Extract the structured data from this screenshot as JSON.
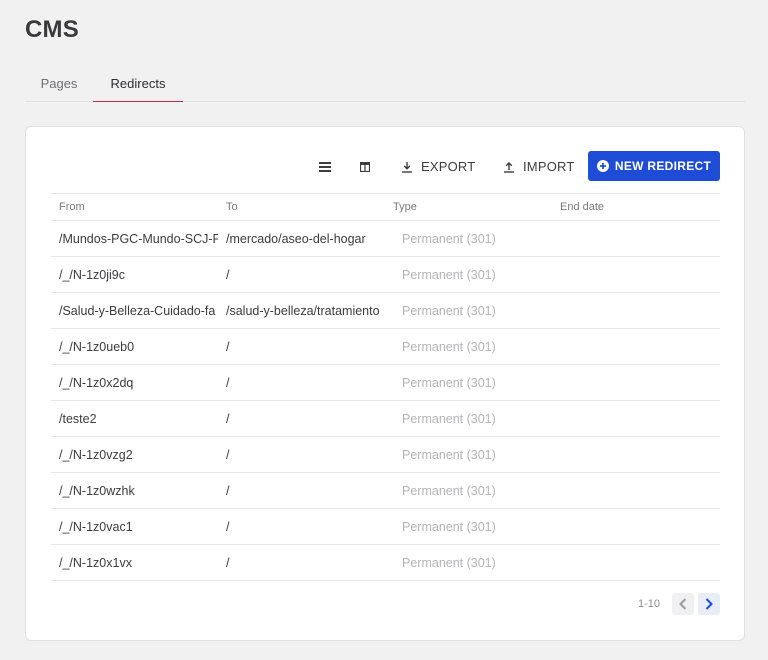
{
  "header": {
    "title": "CMS"
  },
  "tabs": [
    {
      "label": "Pages",
      "active": false
    },
    {
      "label": "Redirects",
      "active": true
    }
  ],
  "toolbar": {
    "density_icon": "density-icon",
    "columns_icon": "columns-icon",
    "export_label": "EXPORT",
    "import_label": "IMPORT",
    "new_label": "NEW REDIRECT",
    "accent_color": "#1e4cd6"
  },
  "table": {
    "columns": [
      "From",
      "To",
      "Type",
      "End date"
    ],
    "rows": [
      {
        "from": "/Mundos-PGC-Mundo-SCJ-F",
        "to": "/mercado/aseo-del-hogar",
        "type": "Permanent (301)",
        "end_date": ""
      },
      {
        "from": "/_/N-1z0ji9c",
        "to": "/",
        "type": "Permanent (301)",
        "end_date": ""
      },
      {
        "from": "/Salud-y-Belleza-Cuidado-fa",
        "to": "/salud-y-belleza/tratamiento",
        "type": "Permanent (301)",
        "end_date": ""
      },
      {
        "from": "/_/N-1z0ueb0",
        "to": "/",
        "type": "Permanent (301)",
        "end_date": ""
      },
      {
        "from": "/_/N-1z0x2dq",
        "to": "/",
        "type": "Permanent (301)",
        "end_date": ""
      },
      {
        "from": "/teste2",
        "to": "/",
        "type": "Permanent (301)",
        "end_date": ""
      },
      {
        "from": "/_/N-1z0vzg2",
        "to": "/",
        "type": "Permanent (301)",
        "end_date": ""
      },
      {
        "from": "/_/N-1z0wzhk",
        "to": "/",
        "type": "Permanent (301)",
        "end_date": ""
      },
      {
        "from": "/_/N-1z0vac1",
        "to": "/",
        "type": "Permanent (301)",
        "end_date": ""
      },
      {
        "from": "/_/N-1z0x1vx",
        "to": "/",
        "type": "Permanent (301)",
        "end_date": ""
      }
    ]
  },
  "pagination": {
    "range": "1-10"
  }
}
